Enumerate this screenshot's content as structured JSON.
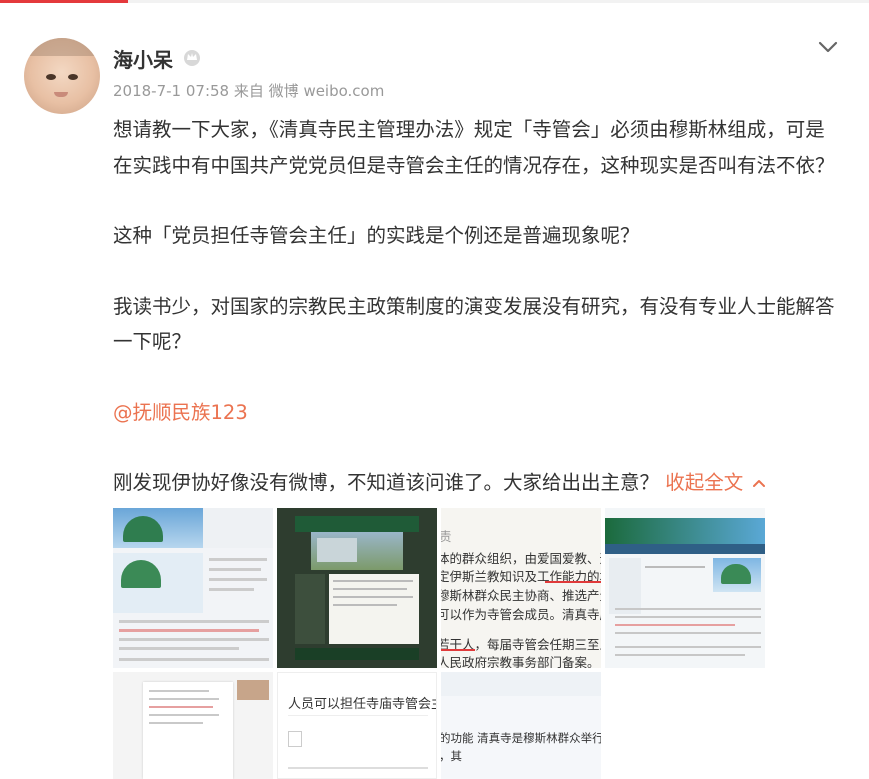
{
  "post": {
    "author": "海小呆",
    "timestamp": "2018-7-1 07:58",
    "source_prefix": "来自",
    "source": "微博 weibo.com",
    "paragraphs": [
      "想请教一下大家，《清真寺民主管理办法》规定「寺管会」必须由穆斯林组成，可是在实践中有中国共产党党员但是寺管会主任的情况存在，这种现实是否叫有法不依？",
      "这种「党员担任寺管会主任」的实践是个例还是普遍现象呢？",
      "我读书少，对国家的宗教民主政策制度的演变发展没有研究，有没有专业人士能解答一下呢？"
    ],
    "mention": "@抚顺民族123",
    "last_line": "刚发现伊协好像没有微博，不知道该问谁了。大家给出出主意？",
    "collapse_label": "收起全文"
  },
  "images": {
    "t3_caption_1": "体的群众组织，由爱国爱教、遵纪守法、",
    "t3_caption_2": "穆斯林群众民主协商、推选产生。本寺",
    "t3_caption_3": "可以作为寺管会成员。清真寺应当结合",
    "t3_caption_4": "若干人，每届寺管会任期三至五年，",
    "t3_caption_5": "人民政府宗教事务部门备案。",
    "t6_title": "人员可以担任寺庙寺管会主任吗",
    "t7_line_1": "的功能 清真寺是穆斯林群众举行宗教活动",
    "t7_line_2": "，其"
  },
  "icons": {
    "badge": "crown-badge-icon",
    "more": "chevron-down-icon",
    "collapse": "chevron-up-icon"
  },
  "colors": {
    "link": "#eb7350",
    "text": "#333333",
    "meta": "#999999",
    "accent_red": "#e4393c"
  }
}
